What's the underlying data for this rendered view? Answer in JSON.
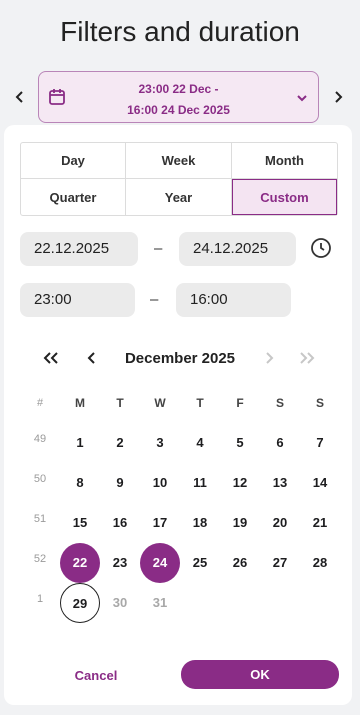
{
  "title": "Filters and duration",
  "range": {
    "line1": "23:00 22 Dec -",
    "line2": "16:00 24 Dec 2025"
  },
  "icons": {
    "prev": "chevron-left-icon",
    "next": "chevron-right-icon",
    "calendar": "calendar-icon",
    "dropdown": "chevron-down-icon",
    "clock": "clock-icon"
  },
  "segments": [
    {
      "label": "Day",
      "active": false
    },
    {
      "label": "Week",
      "active": false
    },
    {
      "label": "Month",
      "active": false
    },
    {
      "label": "Quarter",
      "active": false
    },
    {
      "label": "Year",
      "active": false
    },
    {
      "label": "Custom",
      "active": true
    }
  ],
  "start_date": "22.12.2025",
  "end_date": "24.12.2025",
  "start_time": "23:00",
  "end_time": "16:00",
  "dash": "–",
  "calendar": {
    "month_label": "December 2025",
    "nav": {
      "first": "«",
      "prev": "‹",
      "next": "›",
      "last": "»"
    },
    "weekday_headers": [
      "#",
      "M",
      "T",
      "W",
      "T",
      "F",
      "S",
      "S"
    ],
    "weeks": [
      {
        "week": "49",
        "days": [
          "1",
          "2",
          "3",
          "4",
          "5",
          "6",
          "7"
        ]
      },
      {
        "week": "50",
        "days": [
          "8",
          "9",
          "10",
          "11",
          "12",
          "13",
          "14"
        ]
      },
      {
        "week": "51",
        "days": [
          "15",
          "16",
          "17",
          "18",
          "19",
          "20",
          "21"
        ]
      },
      {
        "week": "52",
        "days": [
          "22",
          "23",
          "24",
          "25",
          "26",
          "27",
          "28"
        ]
      },
      {
        "week": "1",
        "days": [
          "29",
          "30",
          "31"
        ]
      }
    ],
    "range_start": "22",
    "range_end": "24",
    "today": "29",
    "muted_days": [
      "30",
      "31"
    ]
  },
  "actions": {
    "cancel": "Cancel",
    "ok": "OK"
  },
  "colors": {
    "accent": "#8a2c86",
    "accent_light": "#f4e4f2"
  }
}
